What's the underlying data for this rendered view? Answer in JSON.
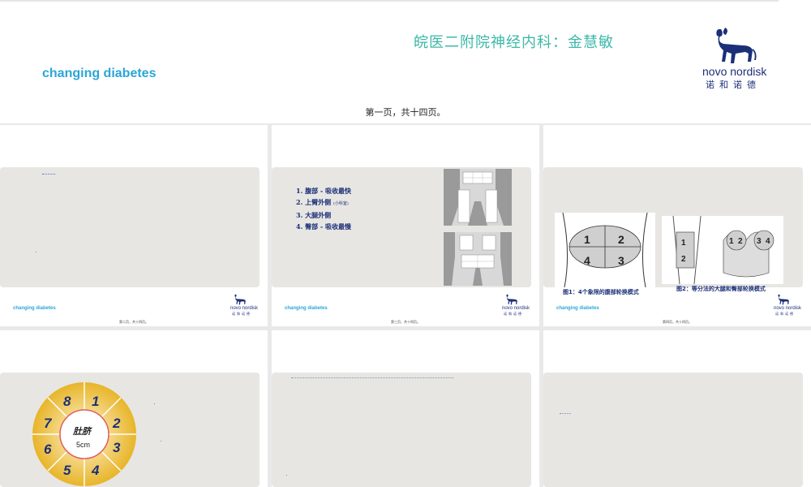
{
  "header": {
    "hospital_text": "皖医二附院神经内科：金慧敏",
    "brand": "changing diabetes",
    "logo_text": "novo nordisk",
    "logo_cn": "诺和诺德",
    "page_label": "第一页，共十四页。"
  },
  "thumbnails": [
    {
      "page_label": "第二页，共十四页。"
    },
    {
      "page_label": "第三页，共十四页。",
      "list": [
        "1. 腹部 - 吸收最快",
        "2. 上臂外侧",
        "(小科室)",
        "3. 大腿外侧",
        "4. 臀部 - 吸收最慢"
      ]
    },
    {
      "page_label": "第四页，共十四页。",
      "caption1": "图1：4个象限的腹部轮换模式",
      "caption2": "图2：等分法的大腿和臀部轮换模式"
    },
    {
      "center": "肚脐",
      "distance": "5cm",
      "numbers": [
        "1",
        "2",
        "3",
        "4",
        "5",
        "6",
        "7",
        "8"
      ]
    },
    {},
    {}
  ],
  "colors": {
    "brand_blue": "#2aa6d6",
    "novo_blue": "#1b2f78",
    "hospital_teal": "#3db8a8"
  }
}
